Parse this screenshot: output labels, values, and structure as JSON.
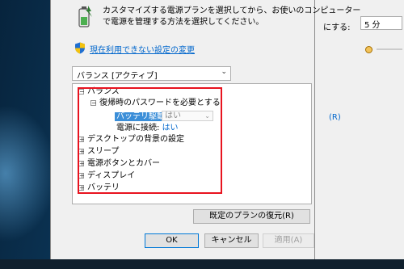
{
  "dialog": {
    "description_lines": [
      "カスタマイズする電源プランを選択してから、お使いのコンピューター",
      "で電源を管理する方法を選択してください。"
    ],
    "link_text": "現在利用できない設定の変更",
    "plan_select_value": "バランス [アクティブ]",
    "tree": {
      "plan_name": "バランス",
      "password_setting": "復帰時のパスワードを必要とする",
      "battery_label": "バッテリ駆動:",
      "battery_value": "はい",
      "plugged_label": "電源に接続:",
      "plugged_value": "はい",
      "items": [
        "デスクトップの背景の設定",
        "スリープ",
        "電源ボタンとカバー",
        "ディスプレイ",
        "バッテリ"
      ]
    },
    "buttons": {
      "restore": "既定のプランの復元(R)",
      "ok": "OK",
      "cancel": "キャンセル",
      "apply": "適用(A)"
    }
  },
  "background_window": {
    "label": "にする:",
    "select_value": "5 分",
    "link_text": "(R)"
  },
  "colors": {
    "highlight_border": "#e8131f",
    "link": "#0066cc",
    "selection": "#3b8ed8"
  },
  "icons": {
    "header": "power-battery-icon",
    "shield": "uac-shield-icon"
  }
}
